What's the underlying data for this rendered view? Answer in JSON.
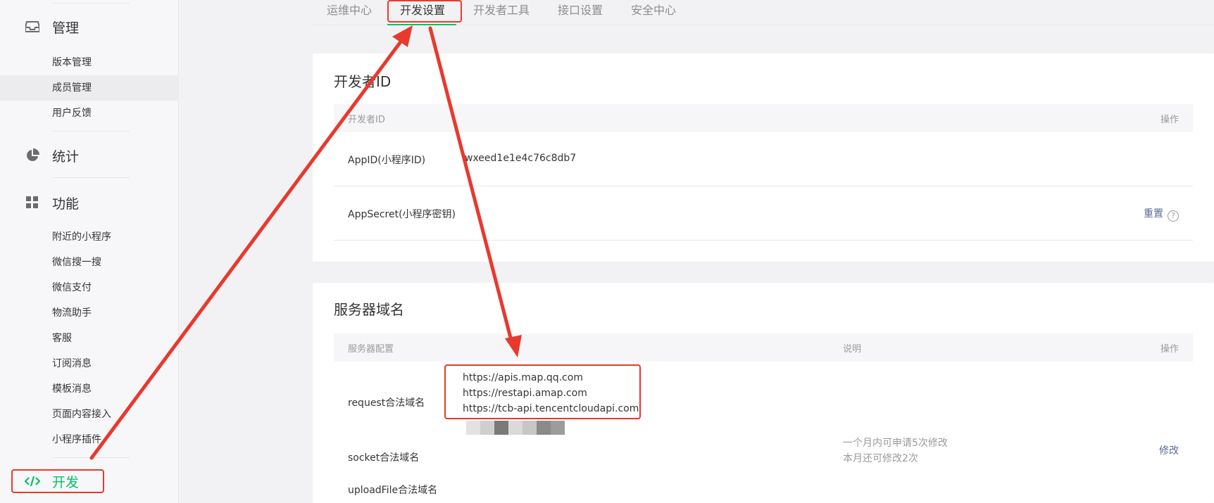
{
  "sidebar": {
    "manage": {
      "label": "管理",
      "icon": "inbox-icon"
    },
    "manage_items": [
      "版本管理",
      "成员管理",
      "用户反馈"
    ],
    "stats": {
      "label": "统计",
      "icon": "pie-chart-icon"
    },
    "features": {
      "label": "功能",
      "icon": "grid-icon"
    },
    "feature_items": [
      "附近的小程序",
      "微信搜一搜",
      "微信支付",
      "物流助手",
      "客服",
      "订阅消息",
      "模板消息",
      "页面内容接入",
      "小程序插件"
    ],
    "dev": {
      "label": "开发",
      "icon": "code-icon"
    }
  },
  "tabs": [
    "运维中心",
    "开发设置",
    "开发者工具",
    "接口设置",
    "安全中心"
  ],
  "active_tab": "开发设置",
  "developer_id": {
    "title": "开发者ID",
    "header_col1": "开发者ID",
    "header_ops": "操作",
    "appid_label": "AppID(小程序ID)",
    "appid_value": "wxeed1e1e4c76c8db7",
    "secret_label": "AppSecret(小程序密钥)",
    "reset": "重置",
    "help": "?"
  },
  "server_domain": {
    "title": "服务器域名",
    "header_config": "服务器配置",
    "header_desc": "说明",
    "header_ops": "操作",
    "request_label": "request合法域名",
    "request_domains": [
      "https://apis.map.qq.com",
      "https://restapi.amap.com",
      "https://tcb-api.tencentcloudapi.com"
    ],
    "socket_label": "socket合法域名",
    "upload_label": "uploadFile合法域名",
    "desc_line1": "一个月内可申请5次修改",
    "desc_line2": "本月还可修改2次",
    "modify": "修改"
  },
  "colors": {
    "accent": "#07c160",
    "annotation": "#e8392d",
    "link": "#576b95"
  }
}
